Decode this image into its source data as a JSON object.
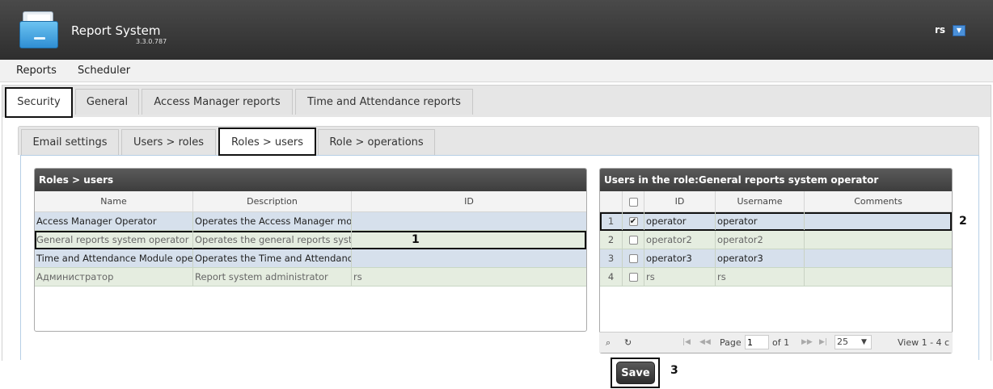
{
  "header": {
    "title": "Report System",
    "version": "3.3.0.787",
    "user": "rs"
  },
  "menu": [
    "Reports",
    "Scheduler"
  ],
  "top_tabs": [
    "Security",
    "General",
    "Access Manager reports",
    "Time and Attendance reports"
  ],
  "sub_tabs": [
    "Email settings",
    "Users > roles",
    "Roles > users",
    "Role > operations"
  ],
  "roles_grid": {
    "caption": "Roles > users",
    "columns": [
      "Name",
      "Description",
      "ID"
    ],
    "rows": [
      {
        "name": "Access Manager Operator",
        "description": "Operates the Access Manager mod",
        "id": ""
      },
      {
        "name": "General reports system operator",
        "description": "Operates the general reports syste",
        "id": ""
      },
      {
        "name": "Time and Attendance Module opera",
        "description": "Operates the Time and Attendance",
        "id": ""
      },
      {
        "name": "Администратор",
        "description": "Report system administrator",
        "id": "rs"
      }
    ]
  },
  "users_grid": {
    "caption": "Users in the role:General reports system operator",
    "columns": [
      "ID",
      "Username",
      "Comments"
    ],
    "rows": [
      {
        "num": "1",
        "checked": true,
        "id": "operator",
        "username": "operator",
        "comments": ""
      },
      {
        "num": "2",
        "checked": false,
        "id": "operator2",
        "username": "operator2",
        "comments": ""
      },
      {
        "num": "3",
        "checked": false,
        "id": "operator3",
        "username": "operator3",
        "comments": ""
      },
      {
        "num": "4",
        "checked": false,
        "id": "rs",
        "username": "rs",
        "comments": ""
      }
    ],
    "pager": {
      "page_label": "Page",
      "page_value": "1",
      "of_label": "of 1",
      "page_size": "25",
      "view_text": "View 1 - 4 c"
    }
  },
  "markers": [
    "1",
    "2",
    "3"
  ],
  "save_label": "Save",
  "colors": {
    "header_bg": "#3a3a3a",
    "row_blue": "#d6e0ec",
    "row_green": "#e5ede0",
    "caption_bg": "#444444"
  }
}
